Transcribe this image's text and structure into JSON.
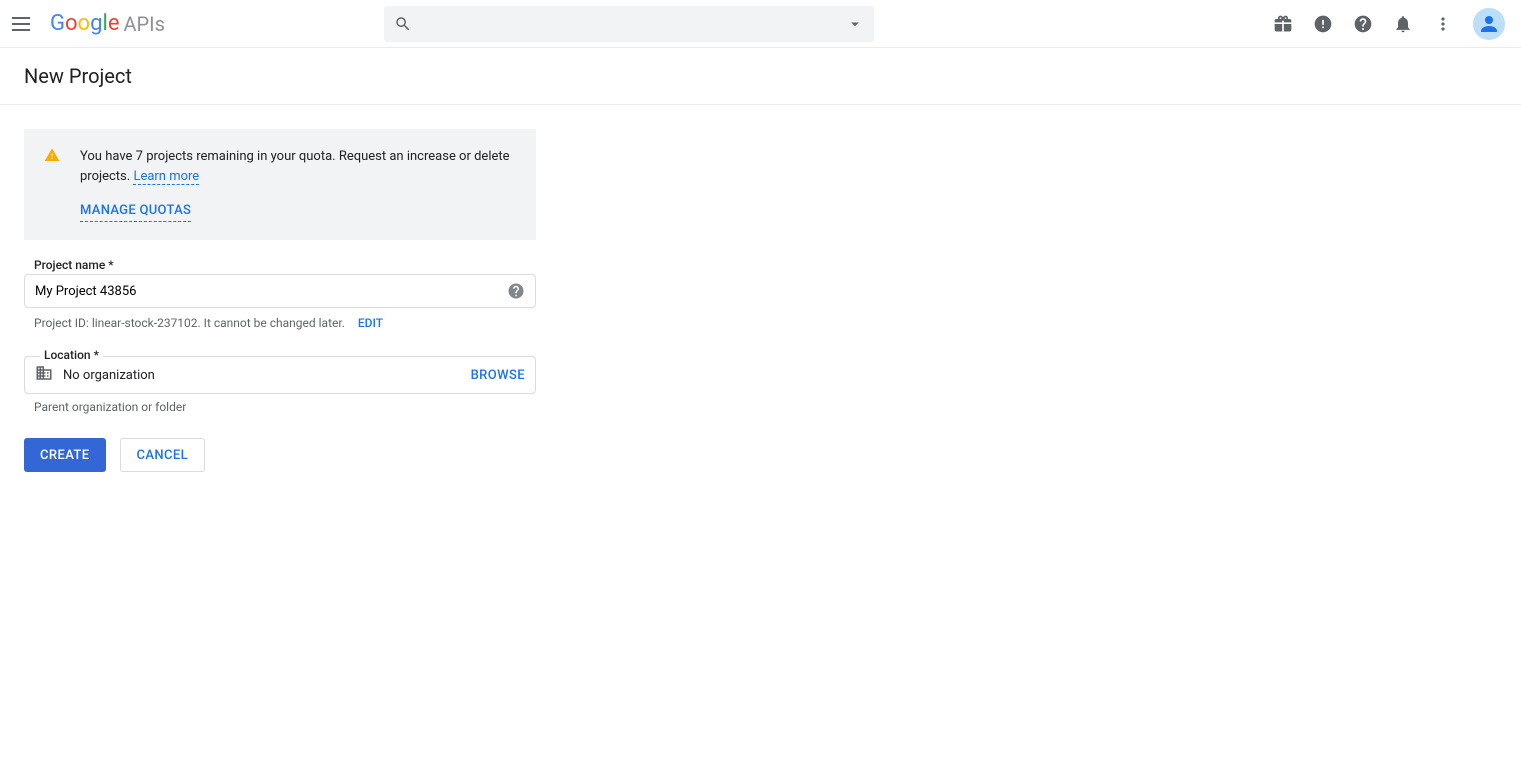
{
  "header": {
    "product": "APIs",
    "search_placeholder": ""
  },
  "page": {
    "title": "New Project"
  },
  "quota": {
    "message": "You have 7 projects remaining in your quota. Request an increase or delete projects.",
    "learn_more": "Learn more",
    "manage_quotas": "MANAGE QUOTAS"
  },
  "form": {
    "project_name_label": "Project name",
    "required_marker": "*",
    "project_name_value": "My Project 43856",
    "project_id_prefix": "Project ID:",
    "project_id_value": "linear-stock-237102. It cannot be changed later.",
    "edit_label": "EDIT",
    "location_label": "Location",
    "location_value": "No organization",
    "browse_label": "BROWSE",
    "location_hint": "Parent organization or folder"
  },
  "actions": {
    "create": "CREATE",
    "cancel": "CANCEL"
  }
}
